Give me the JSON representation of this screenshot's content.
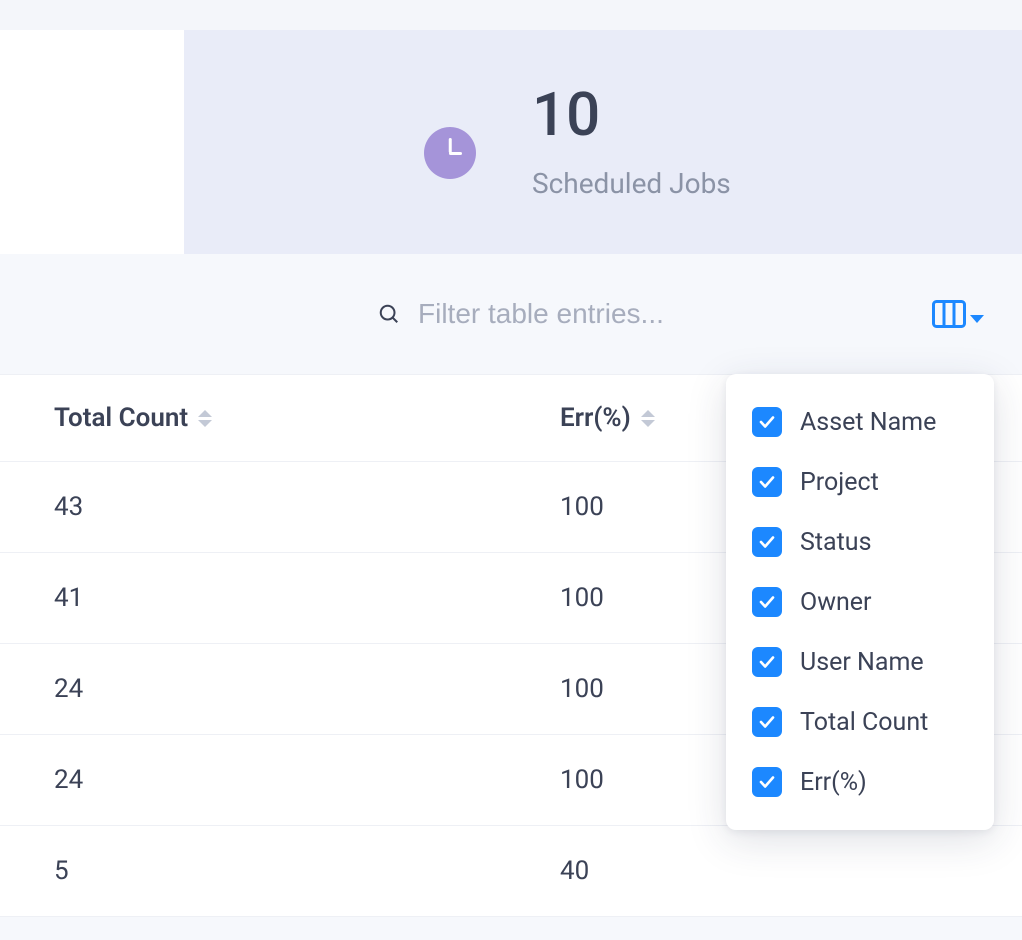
{
  "hero": {
    "value": "10",
    "label": "Scheduled Jobs"
  },
  "filter": {
    "placeholder": "Filter table entries..."
  },
  "columns": {
    "total": "Total Count",
    "err": "Err(%)"
  },
  "rows": [
    {
      "total": "43",
      "err": "100"
    },
    {
      "total": "41",
      "err": "100"
    },
    {
      "total": "24",
      "err": "100"
    },
    {
      "total": "24",
      "err": "100"
    },
    {
      "total": "5",
      "err": "40"
    }
  ],
  "columnMenu": [
    {
      "label": "Asset Name",
      "checked": true
    },
    {
      "label": "Project",
      "checked": true
    },
    {
      "label": "Status",
      "checked": true
    },
    {
      "label": "Owner",
      "checked": true
    },
    {
      "label": "User Name",
      "checked": true
    },
    {
      "label": "Total Count",
      "checked": true
    },
    {
      "label": "Err(%)",
      "checked": true
    }
  ]
}
